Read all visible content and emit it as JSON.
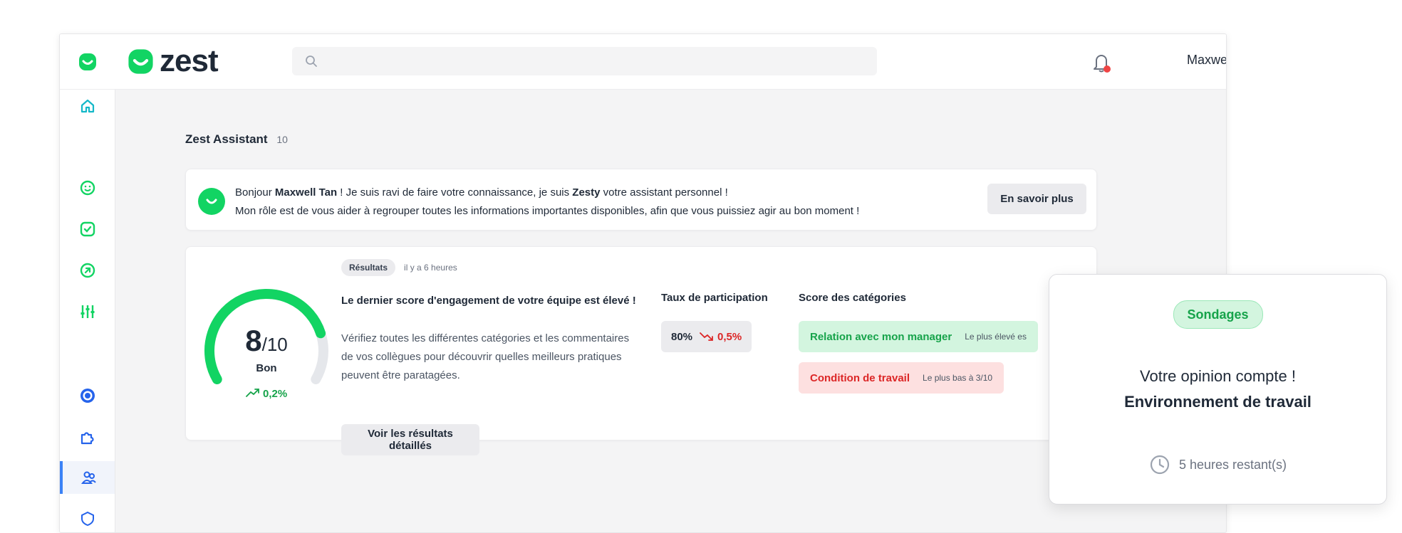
{
  "brand": {
    "name": "zest",
    "color": "#12d463"
  },
  "header": {
    "search_placeholder": "",
    "user_name": "Maxwell",
    "notification_dot_color": "#ef4444"
  },
  "sidebar": {
    "items": [
      {
        "icon": "home-icon",
        "color": "#14b8c8",
        "active": false
      },
      {
        "icon": "smiley-icon",
        "color": "#12d463",
        "active": false
      },
      {
        "icon": "checkbox-icon",
        "color": "#12d463",
        "active": false
      },
      {
        "icon": "arrow-circle-icon",
        "color": "#12d463",
        "active": false
      },
      {
        "icon": "sliders-icon",
        "color": "#12d463",
        "active": false
      },
      {
        "icon": "target-icon",
        "color": "#2563eb",
        "active": false
      },
      {
        "icon": "puzzle-icon",
        "color": "#2563eb",
        "active": false
      },
      {
        "icon": "team-icon",
        "color": "#2563eb",
        "active": true
      }
    ]
  },
  "main": {
    "section_title": "Zest Assistant",
    "section_count": "10"
  },
  "intro": {
    "greeting": "Bonjour",
    "user_full_name": "Maxwell Tan",
    "line1_mid": "! Je suis ravi de faire votre connaissance, je suis",
    "assistant_name": "Zesty",
    "line1_end": "votre assistant personnel !",
    "line2": "Mon rôle est de vous aider à regrouper toutes les informations importantes disponibles, afin que vous puissiez agir au bon moment !",
    "button": "En savoir plus"
  },
  "results": {
    "badge": "Résultats",
    "time": "il y a 6 heures",
    "score": "8",
    "score_max": "/10",
    "score_fraction": 0.8,
    "score_label": "Bon",
    "trend": "0,2%",
    "title": "Le dernier score d'engagement de votre équipe est élevé !",
    "description": "Vérifiez toutes les différentes catégories et les commentaires de vos collègues pour découvrir quelles meilleurs pratiques peuvent être paratagées.",
    "button": "Voir les résultats détaillés",
    "participation": {
      "heading": "Taux de participation",
      "value": "80%",
      "delta": "0,5%"
    },
    "categories": {
      "heading": "Score des catégories",
      "high": {
        "label": "Relation avec mon manager",
        "note": "Le plus élevé es"
      },
      "low": {
        "label": "Condition de travail",
        "note": "Le plus bas à 3/10"
      }
    }
  },
  "survey_popup": {
    "badge": "Sondages",
    "line1": "Votre opinion compte !",
    "line2": "Environnement de travail",
    "time_left": "5 heures restant(s)"
  }
}
